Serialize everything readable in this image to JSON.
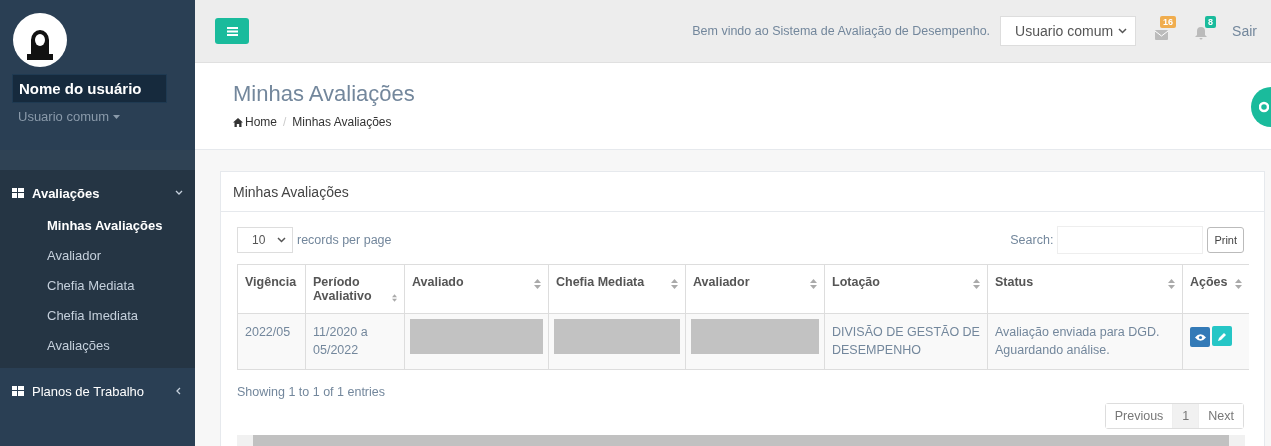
{
  "sidebar": {
    "user_name": "Nome do usuário",
    "role": "Usuario comum",
    "menu": [
      {
        "label": "Avaliações",
        "expanded": true,
        "children": [
          {
            "label": "Minhas Avaliações",
            "selected": true
          },
          {
            "label": "Avaliador",
            "selected": false
          },
          {
            "label": "Chefia Mediata",
            "selected": false
          },
          {
            "label": "Chefia Imediata",
            "selected": false
          },
          {
            "label": "Avaliações",
            "selected": false
          }
        ]
      },
      {
        "label": "Planos de Trabalho",
        "expanded": false
      }
    ]
  },
  "topbar": {
    "welcome": "Bem vindo ao Sistema de Avaliação de Desempenho.",
    "profile_select": "Usuario comum",
    "mail_count": "16",
    "notification_count": "8",
    "logout": "Sair"
  },
  "page_header": {
    "title": "Minhas Avaliações",
    "breadcrumb": [
      "Home",
      "Minhas Avaliações"
    ],
    "breadcrumb_separator": "/"
  },
  "panel": {
    "title": "Minhas Avaliações",
    "page_size": "10",
    "page_size_label": "records per page",
    "search_label": "Search:",
    "print_button": "Print",
    "table": {
      "columns": [
        {
          "label": "Vigência",
          "sortable": false
        },
        {
          "label": "Período Avaliativo",
          "sortable": true
        },
        {
          "label": "Avaliado",
          "sortable": true
        },
        {
          "label": "Chefia Mediata",
          "sortable": true
        },
        {
          "label": "Avaliador",
          "sortable": true
        },
        {
          "label": "Lotação",
          "sortable": true
        },
        {
          "label": "Status",
          "sortable": true
        },
        {
          "label": "Ações",
          "sortable": true
        }
      ],
      "rows": [
        {
          "cells": [
            {
              "kind": "text",
              "text": "2022/05"
            },
            {
              "kind": "text",
              "text": "11/2020 a 05/2022"
            },
            {
              "kind": "redacted"
            },
            {
              "kind": "redacted"
            },
            {
              "kind": "redacted"
            },
            {
              "kind": "text",
              "text": "DIVISÃO DE GESTÃO DE DESEMPENHO"
            },
            {
              "kind": "text",
              "text": "Avaliação enviada para DGD. Aguardando análise."
            },
            {
              "kind": "actions"
            }
          ]
        }
      ]
    },
    "info": "Showing 1 to 1 of 1 entries",
    "pagination": [
      {
        "label": "Previous",
        "selected": false
      },
      {
        "label": "1",
        "selected": true
      },
      {
        "label": "Next",
        "selected": false
      }
    ]
  }
}
